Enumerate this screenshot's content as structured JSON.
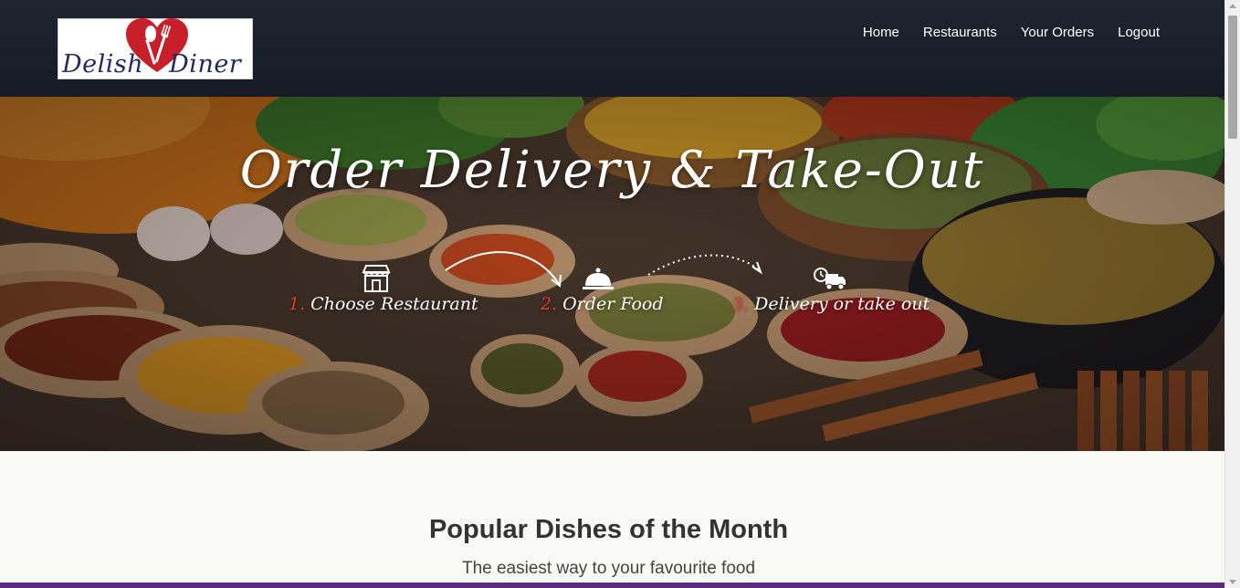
{
  "brand": {
    "logo_text_left": "Delish",
    "logo_text_right": "Diner",
    "heart_color": "#c8202a"
  },
  "nav": {
    "items": [
      {
        "label": "Home"
      },
      {
        "label": "Restaurants"
      },
      {
        "label": "Your Orders"
      },
      {
        "label": "Logout"
      }
    ]
  },
  "hero": {
    "title": "Order Delivery & Take-Out",
    "steps": [
      {
        "number": "1.",
        "label": "Choose Restaurant",
        "icon": "storefront-icon"
      },
      {
        "number": "2.",
        "label": "Order Food",
        "icon": "cloche-icon"
      },
      {
        "number": "3.",
        "label": "Delivery or take out",
        "icon": "delivery-truck-icon"
      }
    ],
    "accent_color": "#e23b24"
  },
  "section": {
    "title": "Popular Dishes of the Month",
    "subtitle": "The easiest way to your favourite food"
  },
  "colors": {
    "navbar": "#1b202b",
    "footer_strip": "#5b2a7a"
  }
}
